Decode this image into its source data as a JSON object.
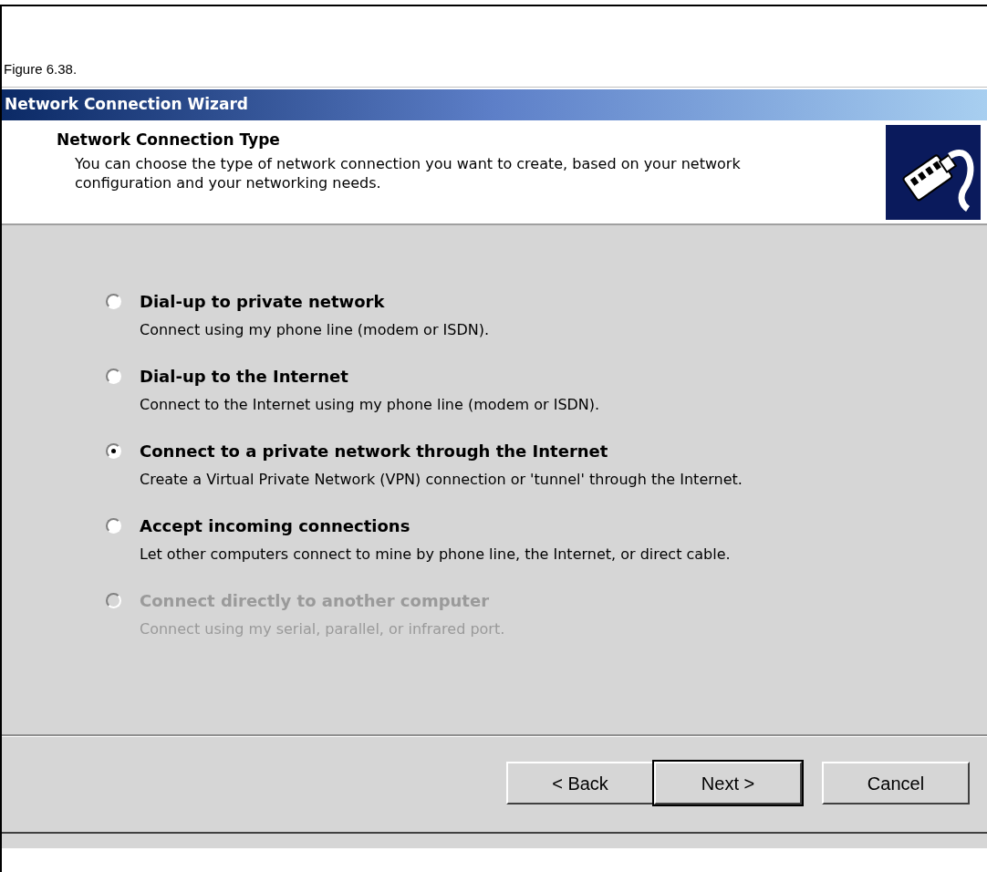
{
  "figure_caption": "Figure 6.38.",
  "window": {
    "title": "Network Connection Wizard"
  },
  "header": {
    "title": "Network Connection Type",
    "description": "You can choose the type of network connection you want to create, based on your network configuration and your networking needs."
  },
  "options": [
    {
      "title": "Dial-up to private network",
      "description": "Connect using my phone line (modem or ISDN).",
      "selected": false,
      "disabled": false
    },
    {
      "title": "Dial-up to the Internet",
      "description": "Connect to the Internet using my phone line (modem or ISDN).",
      "selected": false,
      "disabled": false
    },
    {
      "title": "Connect to a private network through the Internet",
      "description": "Create a Virtual Private Network (VPN) connection or 'tunnel' through the Internet.",
      "selected": true,
      "disabled": false
    },
    {
      "title": "Accept incoming connections",
      "description": "Let other computers connect to mine by phone line, the Internet, or direct cable.",
      "selected": false,
      "disabled": false
    },
    {
      "title": "Connect directly to another computer",
      "description": "Connect using my serial, parallel, or infrared port.",
      "selected": false,
      "disabled": true
    }
  ],
  "buttons": [
    {
      "label": "< Back",
      "default": false
    },
    {
      "label": "Next >",
      "default": true
    },
    {
      "label": "Cancel",
      "default": false
    }
  ]
}
